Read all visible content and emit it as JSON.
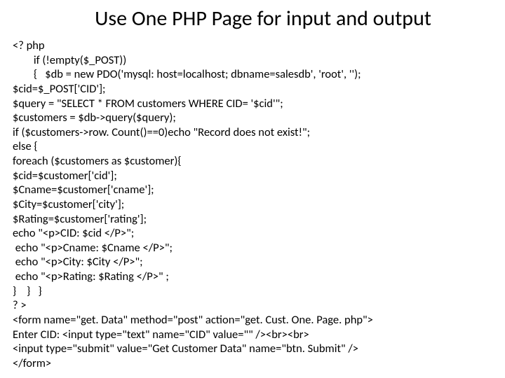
{
  "title": "Use One PHP Page for input and output",
  "code_lines": [
    "<? php",
    "        if (!empty($_POST))",
    "        {   $db = new PDO('mysql: host=localhost; dbname=salesdb', 'root', '');",
    "$cid=$_POST['CID'];",
    "$query = \"SELECT * FROM customers WHERE CID= '$cid'\";",
    "$customers = $db->query($query);",
    "if ($customers->row. Count()==0)echo \"Record does not exist!\";",
    "else {",
    "foreach ($customers as $customer){",
    "$cid=$customer['cid'];",
    "$Cname=$customer['cname'];",
    "$City=$customer['city'];",
    "$Rating=$customer['rating'];",
    "echo \"<p>CID: $cid </P>\";",
    " echo \"<p>Cname: $Cname </P>\";",
    " echo \"<p>City: $City </P>\";",
    " echo \"<p>Rating: $Rating </P>\" ;",
    "}    }   }",
    "? >",
    "<form name=\"get. Data\" method=\"post\" action=\"get. Cust. One. Page. php\">",
    "Enter CID: <input type=\"text\" name=\"CID\" value=\"\" /><br><br>",
    "<input type=\"submit\" value=\"Get Customer Data\" name=\"btn. Submit\" />",
    "</form>"
  ]
}
